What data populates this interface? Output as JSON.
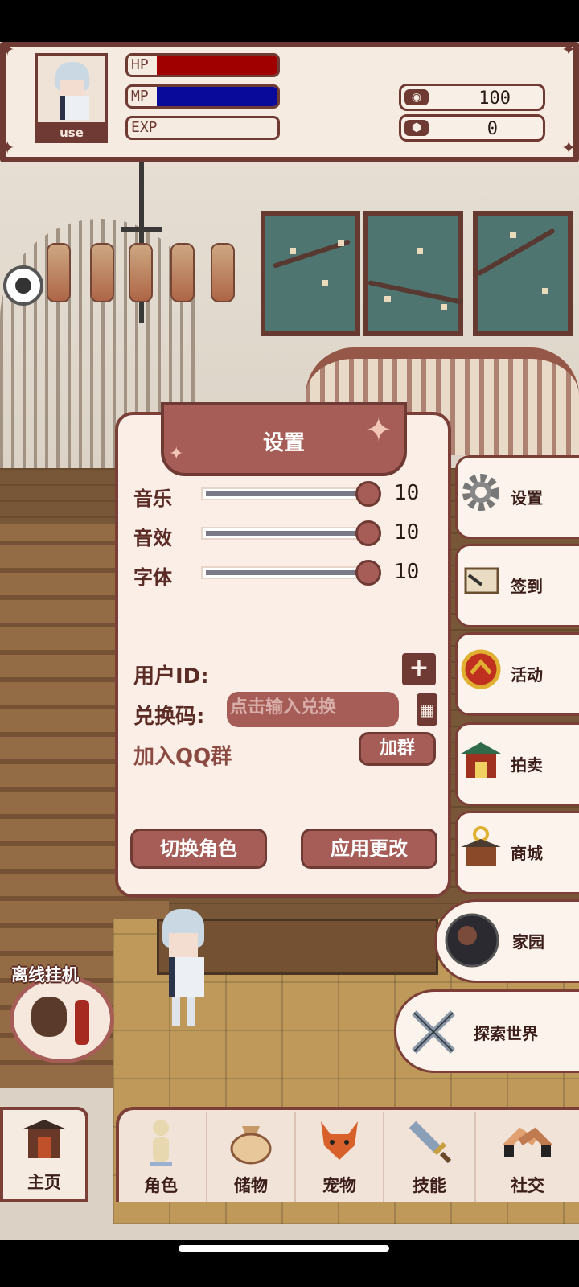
{
  "hud": {
    "avatar_name": "use",
    "hp_label": "HP",
    "mp_label": "MP",
    "exp_label": "EXP",
    "hp_fraction": 1.0,
    "mp_fraction": 1.0,
    "exp_fraction": 0.0,
    "currency": [
      {
        "value": "100"
      },
      {
        "value": "0"
      }
    ],
    "colors": {
      "hp": "#a00000",
      "mp": "#0a0a9a"
    }
  },
  "settings": {
    "title": "设置",
    "sliders": [
      {
        "label": "音乐",
        "value": "10"
      },
      {
        "label": "音效",
        "value": "10"
      },
      {
        "label": "字体",
        "value": "10"
      }
    ],
    "user_id_label": "用户ID:",
    "redeem_label": "兑换码:",
    "redeem_placeholder": "点击输入兑换",
    "qq_label": "加入QQ群",
    "qq_button": "加群",
    "switch_role": "切换角色",
    "apply_changes": "应用更改"
  },
  "right_menu": [
    {
      "label": "设置",
      "icon": "gear-icon"
    },
    {
      "label": "签到",
      "icon": "scroll-icon"
    },
    {
      "label": "活动",
      "icon": "event-icon"
    },
    {
      "label": "拍卖",
      "icon": "auction-house-icon"
    },
    {
      "label": "商城",
      "icon": "shop-icon"
    },
    {
      "label": "家园",
      "icon": "home-orb-icon"
    }
  ],
  "explore": {
    "label": "探索世界",
    "icon": "crossed-swords-icon"
  },
  "idle": {
    "label": "离线挂机"
  },
  "bottom_nav": [
    {
      "label": "主页",
      "icon": "pagoda-icon"
    },
    {
      "label": "角色",
      "icon": "character-icon"
    },
    {
      "label": "储物",
      "icon": "bag-icon"
    },
    {
      "label": "宠物",
      "icon": "fox-icon"
    },
    {
      "label": "技能",
      "icon": "sword-icon"
    },
    {
      "label": "社交",
      "icon": "handshake-icon"
    }
  ]
}
